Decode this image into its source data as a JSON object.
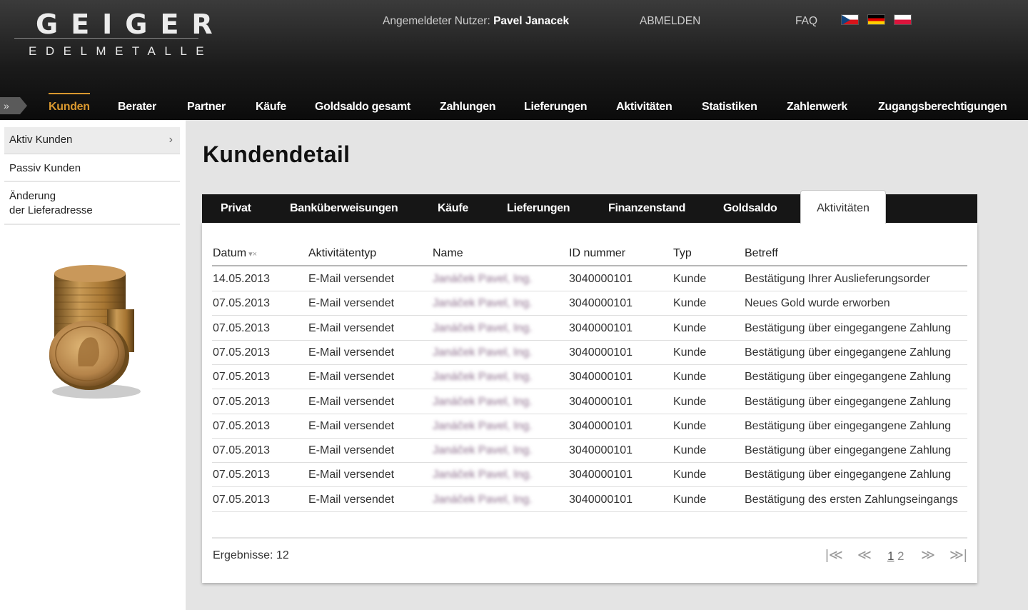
{
  "logo": {
    "line1": "GEIGER",
    "line2": "EDELMETALLE"
  },
  "header": {
    "user_label": "Angemeldeter Nutzer:",
    "user_name": "Pavel Janacek",
    "logout": "ABMELDEN",
    "faq": "FAQ",
    "flags": [
      "flag-cz",
      "flag-de",
      "flag-pl"
    ]
  },
  "nav": {
    "arrow": "»",
    "items": [
      "Kunden",
      "Berater",
      "Partner",
      "Käufe",
      "Goldsaldo gesamt",
      "Zahlungen",
      "Lieferungen",
      "Aktivitäten",
      "Statistiken",
      "Zahlenwerk",
      "Zugangsberechtigungen"
    ],
    "active_color": "#d9982f"
  },
  "sidebar": {
    "items": [
      "Aktiv Kunden",
      "Passiv Kunden",
      "Änderung",
      "der Lieferadresse"
    ],
    "chevron": "›"
  },
  "main": {
    "title": "Kundendetail",
    "tabs": [
      "Privat",
      "Banküberweisungen",
      "Käufe",
      "Lieferungen",
      "Finanzenstand",
      "Goldsaldo",
      "Aktivitäten"
    ],
    "active_tab": "Aktivitäten"
  },
  "table": {
    "headers": [
      "Datum",
      "Aktivitätentyp",
      "Name",
      "ID nummer",
      "Typ",
      "Betreff"
    ],
    "sort_icons": "▾×",
    "rows": [
      [
        "14.05.2013",
        "E-Mail versendet",
        "Janáček Pavel, Ing.",
        "3040000101",
        "Kunde",
        "Bestätigung Ihrer Auslieferungsorder"
      ],
      [
        "07.05.2013",
        "E-Mail versendet",
        "Janáček Pavel, Ing.",
        "3040000101",
        "Kunde",
        "Neues Gold wurde erworben"
      ],
      [
        "07.05.2013",
        "E-Mail versendet",
        "Janáček Pavel, Ing.",
        "3040000101",
        "Kunde",
        "Bestätigung über eingegangene Zahlung"
      ],
      [
        "07.05.2013",
        "E-Mail versendet",
        "Janáček Pavel, Ing.",
        "3040000101",
        "Kunde",
        "Bestätigung über eingegangene Zahlung"
      ],
      [
        "07.05.2013",
        "E-Mail versendet",
        "Janáček Pavel, Ing.",
        "3040000101",
        "Kunde",
        "Bestätigung über eingegangene Zahlung"
      ],
      [
        "07.05.2013",
        "E-Mail versendet",
        "Janáček Pavel, Ing.",
        "3040000101",
        "Kunde",
        "Bestätigung über eingegangene Zahlung"
      ],
      [
        "07.05.2013",
        "E-Mail versendet",
        "Janáček Pavel, Ing.",
        "3040000101",
        "Kunde",
        "Bestätigung über eingegangene Zahlung"
      ],
      [
        "07.05.2013",
        "E-Mail versendet",
        "Janáček Pavel, Ing.",
        "3040000101",
        "Kunde",
        "Bestätigung über eingegangene Zahlung"
      ],
      [
        "07.05.2013",
        "E-Mail versendet",
        "Janáček Pavel, Ing.",
        "3040000101",
        "Kunde",
        "Bestätigung über eingegangene Zahlung"
      ],
      [
        "07.05.2013",
        "E-Mail versendet",
        "Janáček Pavel, Ing.",
        "3040000101",
        "Kunde",
        "Bestätigung des ersten Zahlungseingangs"
      ]
    ]
  },
  "footer": {
    "results": "Ergebnisse: 12",
    "pager": {
      "first": "|≪",
      "prev": "≪",
      "pages": [
        "1",
        "2"
      ],
      "current_page": "1",
      "next": "≫",
      "last": "≫|"
    }
  }
}
